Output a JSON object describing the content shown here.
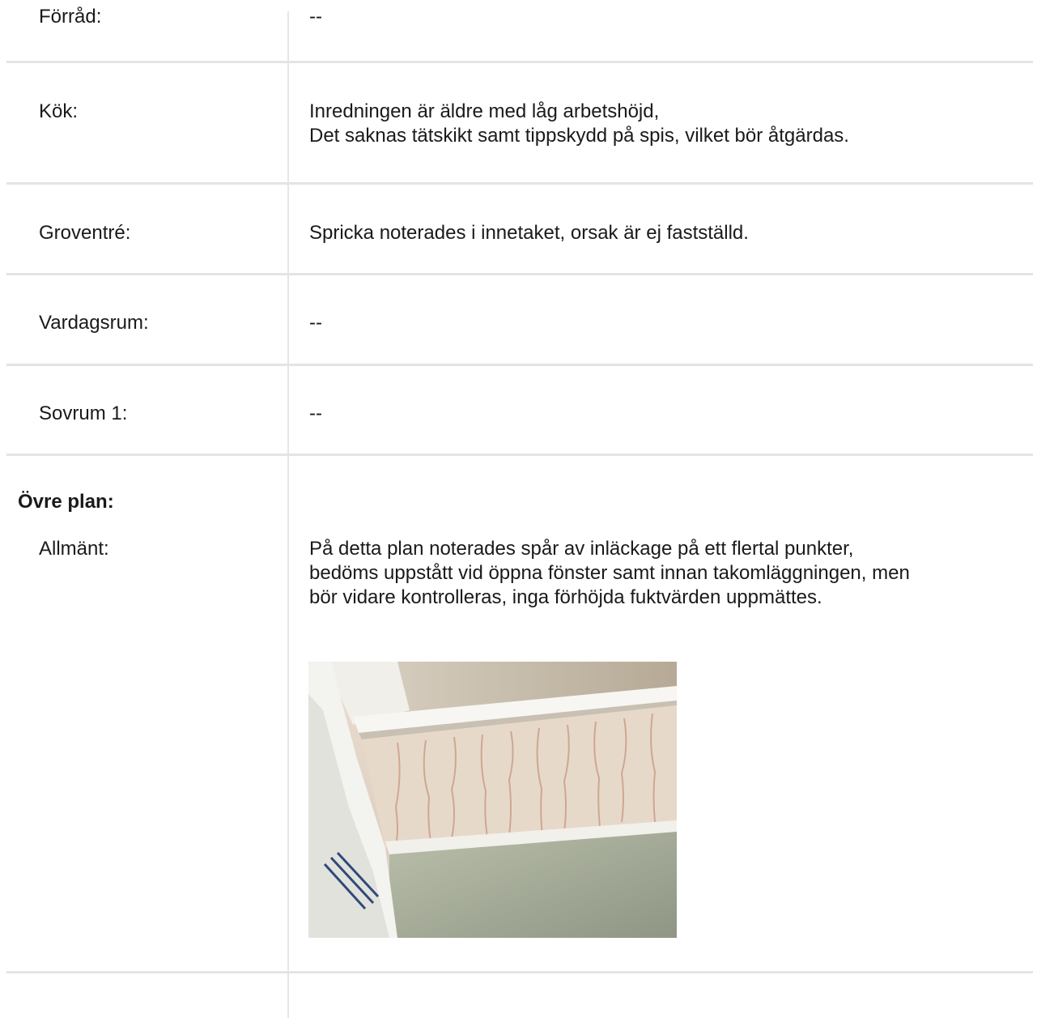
{
  "rows": [
    {
      "label": "Förråd:",
      "value": "--"
    },
    {
      "label": "Kök:",
      "value_lines": [
        "Inredningen är äldre med låg arbetshöjd,",
        "Det saknas tätskikt samt tippskydd på spis, vilket bör åtgärdas."
      ]
    },
    {
      "label": "Groventré:",
      "value": "Spricka noterades i innetaket, orsak är ej fastställd."
    },
    {
      "label": "Vardagsrum:",
      "value": "--"
    },
    {
      "label": "Sovrum 1:",
      "value": "--"
    }
  ],
  "section": {
    "heading": "Övre plan:",
    "rows": [
      {
        "label": "Allmänt:",
        "value_lines": [
          "På detta plan noterades spår av inläckage på ett flertal punkter,",
          "bedöms uppstått vid öppna fönster samt innan takomläggningen, men",
          "bör vidare kontrolleras, inga förhöjda fuktvärden uppmättes."
        ]
      }
    ]
  },
  "photo": {
    "subject": "water-stain-window-sill-photo"
  }
}
